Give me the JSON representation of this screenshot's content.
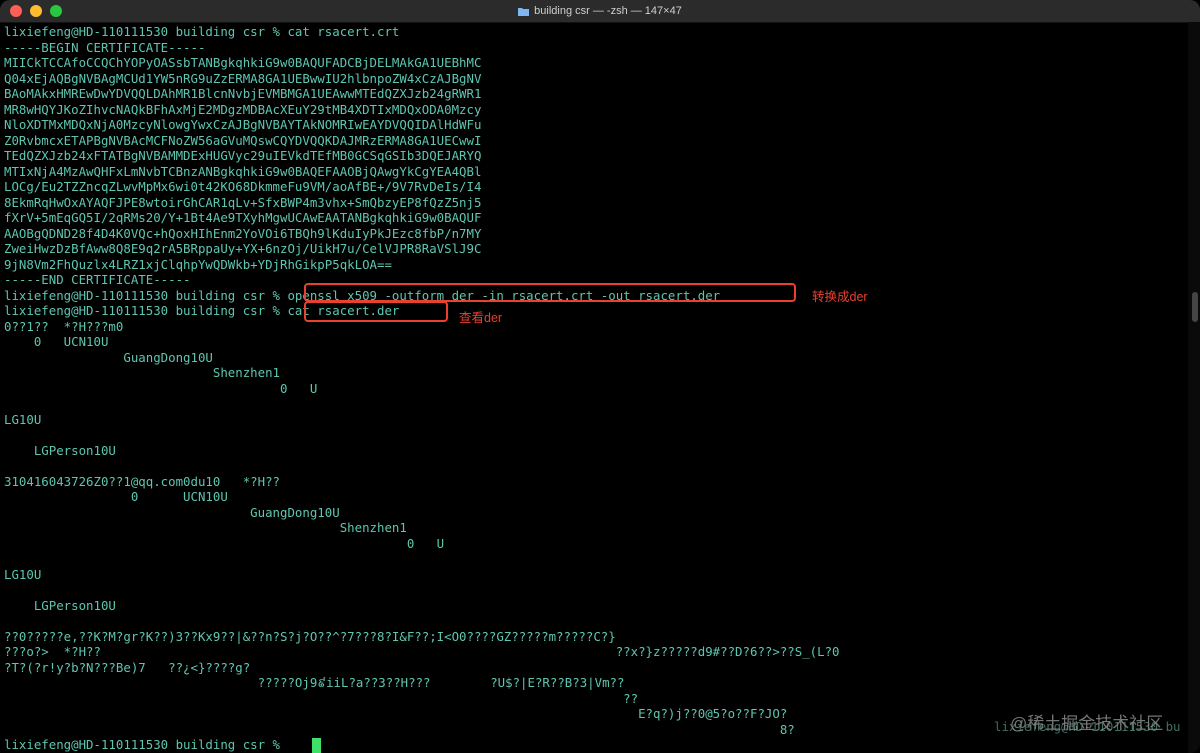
{
  "window": {
    "title": "building csr — -zsh — 147×47"
  },
  "terminal": {
    "lines": [
      "lixiefeng@HD-110111530 building csr % cat rsacert.crt",
      "-----BEGIN CERTIFICATE-----",
      "MIICkTCCAfoCCQChYOPyOASsbTANBgkqhkiG9w0BAQUFADCBjDELMAkGA1UEBhMC",
      "Q04xEjAQBgNVBAgMCUd1YW5nRG9uZzERMA8GA1UEBwwIU2hlbnpoZW4xCzAJBgNV",
      "BAoMAkxHMREwDwYDVQQLDAhMR1BlcnNvbjEVMBMGA1UEAwwMTEdQZXJzb24gRWR1",
      "MR8wHQYJKoZIhvcNAQkBFhAxMjE2MDgzMDBAcXEuY29tMB4XDTIxMDQxODA0Mzcy",
      "NloXDTMxMDQxNjA0MzcyNlowgYwxCzAJBgNVBAYTAkNOMRIwEAYDVQQIDAlHdWFu",
      "Z0RvbmcxETAPBgNVBAcMCFNoZW56aGVuMQswCQYDVQQKDAJMRzERMA8GA1UECwwI",
      "TEdQZXJzb24xFTATBgNVBAMMDExHUGVyc29uIEVkdTEfMB0GCSqGSIb3DQEJARYQ",
      "MTIxNjA4MzAwQHFxLmNvbTCBnzANBgkqhkiG9w0BAQEFAAOBjQAwgYkCgYEA4QBl",
      "LOCg/Eu2TZZncqZLwvMpMx6wi0t42KO68DkmmeFu9VM/aoAfBE+/9V7RvDeIs/I4",
      "8EkmRqHwOxAYAQFJPE8wtoirGhCAR1qLv+SfxBWP4m3vhx+SmQbzyEP8fQzZ5nj5",
      "fXrV+5mEqGQ5I/2qRMs20/Y+1Bt4Ae9TXyhMgwUCAwEAATANBgkqhkiG9w0BAQUF",
      "AAOBgQDND28f4D4K0VQc+hQoxHIhEnm2YoVOi6TBQh9lKduIyPkJEzc8fbP/n7MY",
      "ZweiHwzDzBfAww8Q8E9q2rA5BRppaUy+YX+6nzOj/UikH7u/CelVJPR8RaVSlJ9C",
      "9jN8Vm2FhQuzlx4LRZ1xjClqhpYwQDWkb+YDjRhGikpP5qkLOA==",
      "-----END CERTIFICATE-----",
      "lixiefeng@HD-110111530 building csr % openssl x509 -outform der -in rsacert.crt -out rsacert.der",
      "lixiefeng@HD-110111530 building csr % cat rsacert.der",
      "0??1??  *?H???m0",
      "    0   UCN10U",
      "                GuangDong10U",
      "                            Shenzhen1",
      "                                     0   U",
      "",
      "LG10U",
      "",
      "    LGPerson10U",
      "",
      "310416043726Z0??1@qq.com0du10   *?H??",
      "                 0      UCN10U",
      "                                 GuangDong10U",
      "                                             Shenzhen1",
      "                                                      0   U",
      "",
      "LG10U",
      "",
      "    LGPerson10U",
      "",
      "??0?????e,??K?M?gr?K??)3??Kx9??|&??n?S?j?O??^?7???8?I&F??;I<O0????GZ?????m?????C?}",
      "???o?>  *?H??                                                                     ??x?}z?????d9#??D?6??>??S_(L?0",
      "?T?(?r!y?b?N???Be)7   ??¿<}????g?",
      "                                  ?????Oj9៩iiL?a??3??H???        ?U$?|E?R??B?3|Vm??",
      "                                                                                   ??",
      "                                                                                     E?q?)j??0@5?o??F?JO?",
      "                                                                                                        8?",
      "lixiefeng@HD-110111530 building csr % "
    ],
    "stray_prompt_tail": "lixiefeng@HD-110111530 bu"
  },
  "annotations": {
    "convert_label": "转换成der",
    "view_label": "查看der"
  },
  "watermark": "@稀土掘金技术社区",
  "colors": {
    "terminal_bg": "#000000",
    "terminal_text": "#5ec6b0",
    "annotation": "#e8412f",
    "cursor": "#3ee06a"
  }
}
